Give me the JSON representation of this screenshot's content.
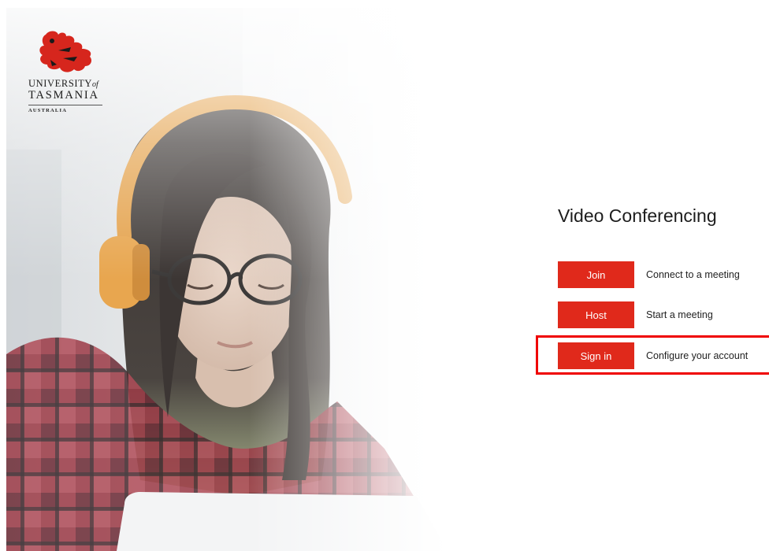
{
  "brand": {
    "line1": "UNIVERSITY",
    "line1_suffix": "of",
    "line2": "TASMANIA",
    "line3": "AUSTRALIA",
    "crest_icon": "red-lion-crest-icon",
    "crest_color": "#d6261d"
  },
  "hero": {
    "icon": "woman-with-headphones-photo"
  },
  "panel": {
    "title": "Video Conferencing",
    "actions": [
      {
        "button": "Join",
        "description": "Connect to a meeting"
      },
      {
        "button": "Host",
        "description": "Start a meeting"
      },
      {
        "button": "Sign in",
        "description": "Configure your account"
      }
    ]
  },
  "colors": {
    "accent": "#e0291b",
    "highlight": "#ef0000"
  }
}
